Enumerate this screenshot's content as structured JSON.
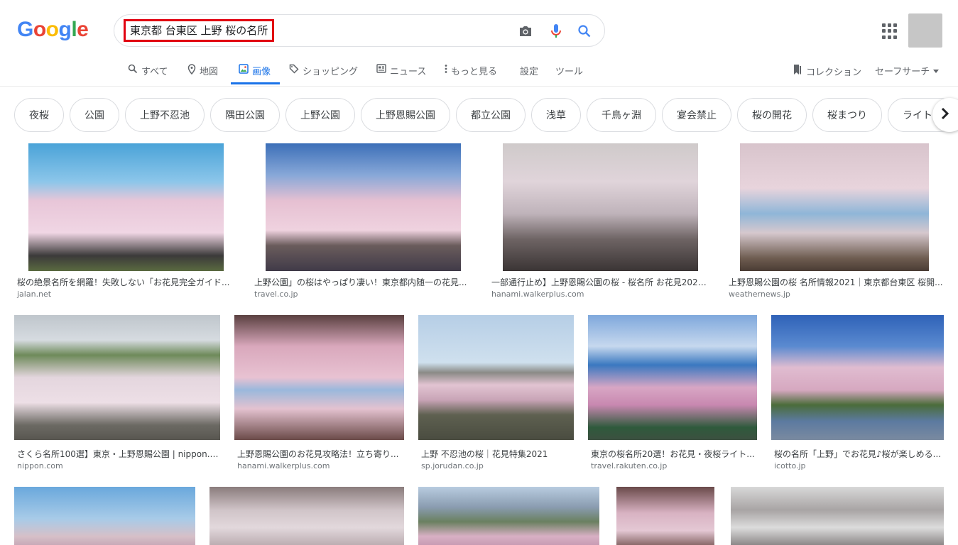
{
  "logo": {
    "letters": [
      "G",
      "o",
      "o",
      "g",
      "l",
      "e"
    ],
    "colors": [
      "#4285f4",
      "#ea4335",
      "#fbbc05",
      "#4285f4",
      "#34a853",
      "#ea4335"
    ]
  },
  "search": {
    "query": "東京都 台東区 上野 桜の名所",
    "camera_icon": "camera-icon",
    "mic_icon": "mic-icon",
    "search_icon": "search-icon"
  },
  "tabs": [
    {
      "label": "すべて",
      "icon": "search-icon"
    },
    {
      "label": "地図",
      "icon": "map-pin-icon"
    },
    {
      "label": "画像",
      "icon": "image-icon"
    },
    {
      "label": "ショッピング",
      "icon": "tag-icon"
    },
    {
      "label": "ニュース",
      "icon": "news-icon"
    },
    {
      "label": "もっと見る",
      "icon": "more-vert-icon"
    },
    {
      "label": "設定"
    },
    {
      "label": "ツール"
    }
  ],
  "right_links": {
    "collections": "コレクション",
    "safesearch": "セーフサーチ"
  },
  "chips": [
    "夜桜",
    "公園",
    "上野不忍池",
    "隅田公園",
    "上野公園",
    "上野恩賜公園",
    "都立公園",
    "浅草",
    "千鳥ヶ淵",
    "宴会禁止",
    "桜の開花",
    "桜まつり",
    "ライト"
  ],
  "results": [
    {
      "title": "桜の絶景名所を網羅！失敗しない「お花見完全ガイド...",
      "source": "jalan.net"
    },
    {
      "title": "上野公園」の桜はやっぱり凄い！東京都内随一の花見...",
      "source": "travel.co.jp"
    },
    {
      "title": "一部通行止め】上野恩賜公園の桜 - 桜名所 お花見2021...",
      "source": "hanami.walkerplus.com"
    },
    {
      "title": "上野恩賜公園の桜 名所情報2021｜東京都台東区 桜開...",
      "source": "weathernews.jp"
    },
    {
      "title": "さくら名所100選】東京・上野恩賜公園 | nippon.c...",
      "source": "nippon.com"
    },
    {
      "title": "上野恩賜公園のお花見攻略法！立ち寄り...",
      "source": "hanami.walkerplus.com"
    },
    {
      "title": "上野 不忍池の桜｜花見特集2021",
      "source": "sp.jorudan.co.jp"
    },
    {
      "title": "東京の桜名所20選！お花見・夜桜ライト...",
      "source": "travel.rakuten.co.jp"
    },
    {
      "title": "桜の名所「上野」でお花見♪桜が楽しめる...",
      "source": "icotto.jp"
    },
    {
      "title": "",
      "source": ""
    },
    {
      "title": "",
      "source": ""
    },
    {
      "title": "",
      "source": ""
    },
    {
      "title": "",
      "source": ""
    },
    {
      "title": "",
      "source": ""
    }
  ],
  "colors": {
    "accent": "#1a73e8",
    "query_highlight": "#e1000f"
  }
}
